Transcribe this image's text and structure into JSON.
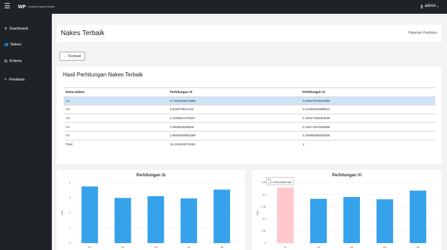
{
  "topbar": {
    "menu_icon": "☰",
    "brand": "WP",
    "brand_sub": "Pemilihan Nakes Terbaik",
    "user_icon": "user-icon",
    "user_label": "admin",
    "caret": "▾"
  },
  "sidebar": {
    "items": [
      {
        "icon": "dashboard-icon",
        "glyph": "⚙",
        "label": "Dashboard"
      },
      {
        "icon": "users-icon",
        "glyph": "👥",
        "label": "Nakes"
      },
      {
        "icon": "list-icon",
        "glyph": "▤",
        "label": "Kriteria"
      },
      {
        "icon": "edit-icon",
        "glyph": "✎",
        "label": "Penilaian"
      }
    ]
  },
  "header": {
    "title": "Nakes Terbaik",
    "breadcrumb": "Halaman Penilaian"
  },
  "back_button": {
    "arrow": "←",
    "label": "Kembali"
  },
  "results": {
    "title": "Hasil Perhitungan Nakes Terbaik",
    "columns": [
      "Nama Nakes",
      "Perhitungan Si",
      "Perhitungan Vi"
    ],
    "rows": [
      {
        "name": "A1",
        "si": "3.7431684871956",
        "vi": "0.22947875847969"
      },
      {
        "name": "A5",
        "si": "3.533078621434",
        "vi": "0.21664802998814"
      },
      {
        "name": "A3",
        "si": "3.1036911478307",
        "vi": "0.19027494854826"
      },
      {
        "name": "A2",
        "si": "2.983364006849",
        "vi": "0.18271427848096"
      },
      {
        "name": "A4",
        "si": "2.9505093853369",
        "vi": "0.18088098450295"
      },
      {
        "name": "Total",
        "si": "16.311653072482",
        "vi": "1"
      }
    ]
  },
  "colors": {
    "bar": "#36a2eb",
    "bar_highlight": "#ffc8cd",
    "sidebar_bg": "#1f2226",
    "selected_row": "#cfe2f7"
  },
  "chart_data": [
    {
      "type": "bar",
      "title": "Perhitungan Si",
      "ylabel": "Nilai",
      "categories": [
        "A1",
        "A2",
        "A3",
        "A4",
        "A5"
      ],
      "values": [
        3.74,
        2.98,
        3.1,
        2.95,
        3.53
      ],
      "ylim": [
        0,
        4
      ],
      "yticks": [
        "0",
        "1",
        "2",
        "3",
        "4"
      ],
      "grid": true
    },
    {
      "type": "bar",
      "title": "Perhitungan Vi",
      "ylabel": "Nilai",
      "categories": [
        "A1",
        "A2",
        "A3",
        "A4",
        "A5"
      ],
      "values": [
        0.2295,
        0.1827,
        0.1903,
        0.1809,
        0.2166
      ],
      "ylim": [
        0,
        0.25
      ],
      "yticks": [
        "0",
        "0.05",
        "0.1",
        "0.15",
        "0.2",
        "0.25"
      ],
      "grid": true,
      "highlighted_index": 0,
      "tooltip": {
        "category": "A1",
        "value": "0.22947875847969"
      }
    }
  ]
}
